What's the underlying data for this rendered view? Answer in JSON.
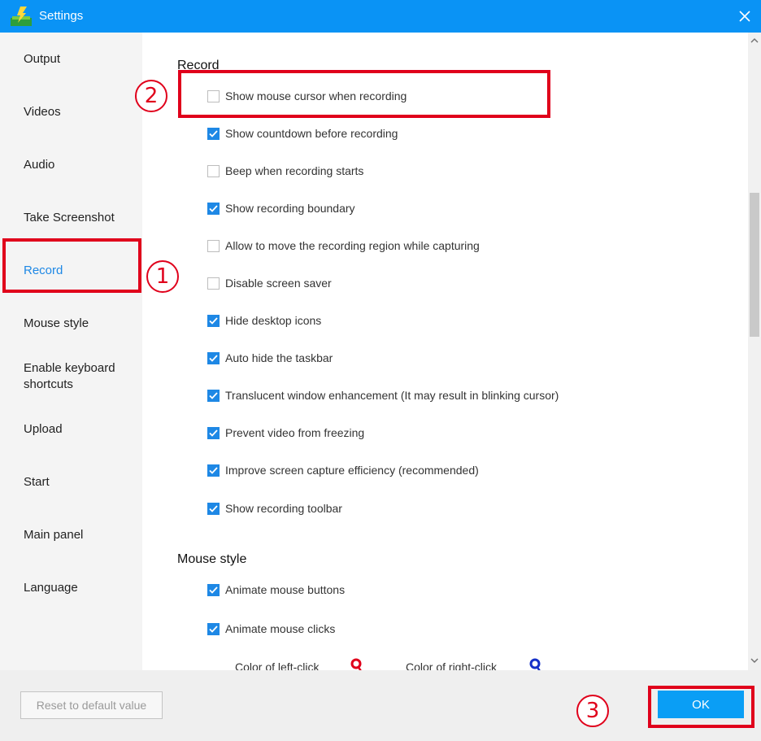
{
  "window": {
    "title": "Settings"
  },
  "sidebar": {
    "items": [
      {
        "label": "Output"
      },
      {
        "label": "Videos"
      },
      {
        "label": "Audio"
      },
      {
        "label": "Take Screenshot"
      },
      {
        "label": "Record"
      },
      {
        "label": "Mouse style"
      },
      {
        "label": "Enable keyboard shortcuts"
      },
      {
        "label": "Upload"
      },
      {
        "label": "Start"
      },
      {
        "label": "Main panel"
      },
      {
        "label": "Language"
      }
    ],
    "active_item": "Record"
  },
  "record_section": {
    "title": "Record",
    "options": [
      {
        "label": "Show mouse cursor when recording",
        "checked": false
      },
      {
        "label": "Show countdown before recording",
        "checked": true
      },
      {
        "label": "Beep when recording starts",
        "checked": false
      },
      {
        "label": "Show recording boundary",
        "checked": true
      },
      {
        "label": "Allow to move the recording region while capturing",
        "checked": false
      },
      {
        "label": "Disable screen saver",
        "checked": false
      },
      {
        "label": "Hide desktop icons",
        "checked": true
      },
      {
        "label": "Auto hide the taskbar",
        "checked": true
      },
      {
        "label": "Translucent window enhancement (It may result in blinking cursor)",
        "checked": true
      },
      {
        "label": "Prevent video from freezing",
        "checked": true
      },
      {
        "label": "Improve screen capture efficiency (recommended)",
        "checked": true
      },
      {
        "label": "Show recording toolbar",
        "checked": true
      }
    ]
  },
  "mouse_section": {
    "title": "Mouse style",
    "options": [
      {
        "label": "Animate mouse buttons",
        "checked": true
      },
      {
        "label": "Animate mouse clicks",
        "checked": true
      }
    ],
    "left_click_label": "Color of left-click",
    "left_click_color": "#e0001b",
    "right_click_label": "Color of right-click",
    "right_click_color": "#1530c8"
  },
  "footer": {
    "reset_label": "Reset to default value",
    "ok_label": "OK"
  },
  "callouts": {
    "one": "1",
    "two": "2",
    "three": "3"
  },
  "colors": {
    "titlebar": "#0a93f5",
    "accent": "#1e88e5",
    "callout": "#e0001b",
    "ok_button": "#0a9ef5"
  }
}
